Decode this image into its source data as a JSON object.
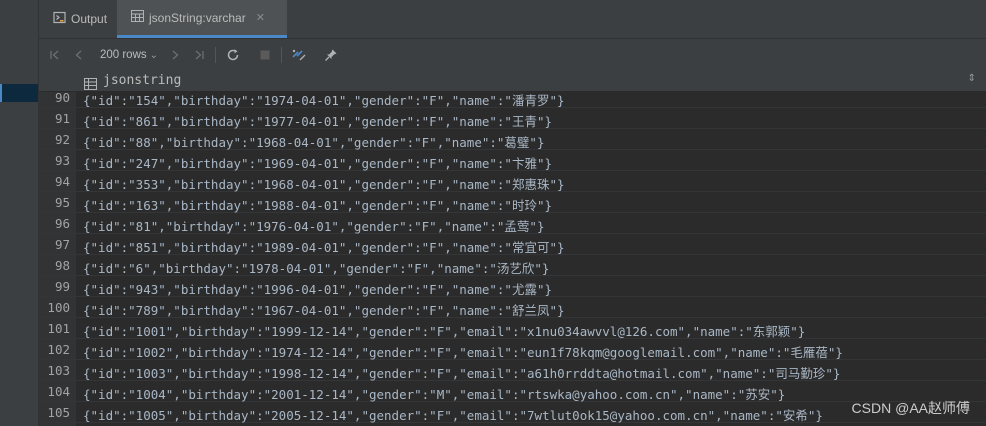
{
  "tabs": [
    {
      "label": "Output",
      "icon": "output-icon",
      "active": false
    },
    {
      "label": "jsonString:varchar",
      "icon": "table-icon",
      "active": true
    }
  ],
  "toolbar": {
    "rows_label": "200 rows",
    "rows_chevron": "⌄"
  },
  "column": {
    "name": "jsonstring",
    "sort_glyph": "⇕"
  },
  "rows": [
    {
      "num": "90",
      "value": "{\"id\":\"154\",\"birthday\":\"1974-04-01\",\"gender\":\"F\",\"name\":\"潘青罗\"}"
    },
    {
      "num": "91",
      "value": "{\"id\":\"861\",\"birthday\":\"1977-04-01\",\"gender\":\"F\",\"name\":\"王青\"}"
    },
    {
      "num": "92",
      "value": "{\"id\":\"88\",\"birthday\":\"1968-04-01\",\"gender\":\"F\",\"name\":\"葛璧\"}"
    },
    {
      "num": "93",
      "value": "{\"id\":\"247\",\"birthday\":\"1969-04-01\",\"gender\":\"F\",\"name\":\"卞雅\"}"
    },
    {
      "num": "94",
      "value": "{\"id\":\"353\",\"birthday\":\"1968-04-01\",\"gender\":\"F\",\"name\":\"郑惠珠\"}"
    },
    {
      "num": "95",
      "value": "{\"id\":\"163\",\"birthday\":\"1988-04-01\",\"gender\":\"F\",\"name\":\"时玲\"}"
    },
    {
      "num": "96",
      "value": "{\"id\":\"81\",\"birthday\":\"1976-04-01\",\"gender\":\"F\",\"name\":\"孟莺\"}"
    },
    {
      "num": "97",
      "value": "{\"id\":\"851\",\"birthday\":\"1989-04-01\",\"gender\":\"F\",\"name\":\"常宜可\"}"
    },
    {
      "num": "98",
      "value": "{\"id\":\"6\",\"birthday\":\"1978-04-01\",\"gender\":\"F\",\"name\":\"汤艺欣\"}"
    },
    {
      "num": "99",
      "value": "{\"id\":\"943\",\"birthday\":\"1996-04-01\",\"gender\":\"F\",\"name\":\"尤露\"}"
    },
    {
      "num": "100",
      "value": "{\"id\":\"789\",\"birthday\":\"1967-04-01\",\"gender\":\"F\",\"name\":\"舒兰凤\"}"
    },
    {
      "num": "101",
      "value": "{\"id\":\"1001\",\"birthday\":\"1999-12-14\",\"gender\":\"F\",\"email\":\"x1nu034awvvl@126.com\",\"name\":\"东郭颖\"}"
    },
    {
      "num": "102",
      "value": "{\"id\":\"1002\",\"birthday\":\"1974-12-14\",\"gender\":\"F\",\"email\":\"eun1f78kqm@googlemail.com\",\"name\":\"毛雁蓓\"}"
    },
    {
      "num": "103",
      "value": "{\"id\":\"1003\",\"birthday\":\"1998-12-14\",\"gender\":\"F\",\"email\":\"a61h0rrddta@hotmail.com\",\"name\":\"司马勤珍\"}"
    },
    {
      "num": "104",
      "value": "{\"id\":\"1004\",\"birthday\":\"2001-12-14\",\"gender\":\"M\",\"email\":\"rtswka@yahoo.com.cn\",\"name\":\"苏安\"}"
    },
    {
      "num": "105",
      "value": "{\"id\":\"1005\",\"birthday\":\"2005-12-14\",\"gender\":\"F\",\"email\":\"7wtlut0ok15@yahoo.com.cn\",\"name\":\"安希\"}"
    }
  ],
  "watermark": "CSDN @AA赵师傅",
  "colors": {
    "background": "#2b2b2b",
    "panel": "#3c3f41",
    "accent": "#4a88c7",
    "text": "#a9b7c6"
  }
}
